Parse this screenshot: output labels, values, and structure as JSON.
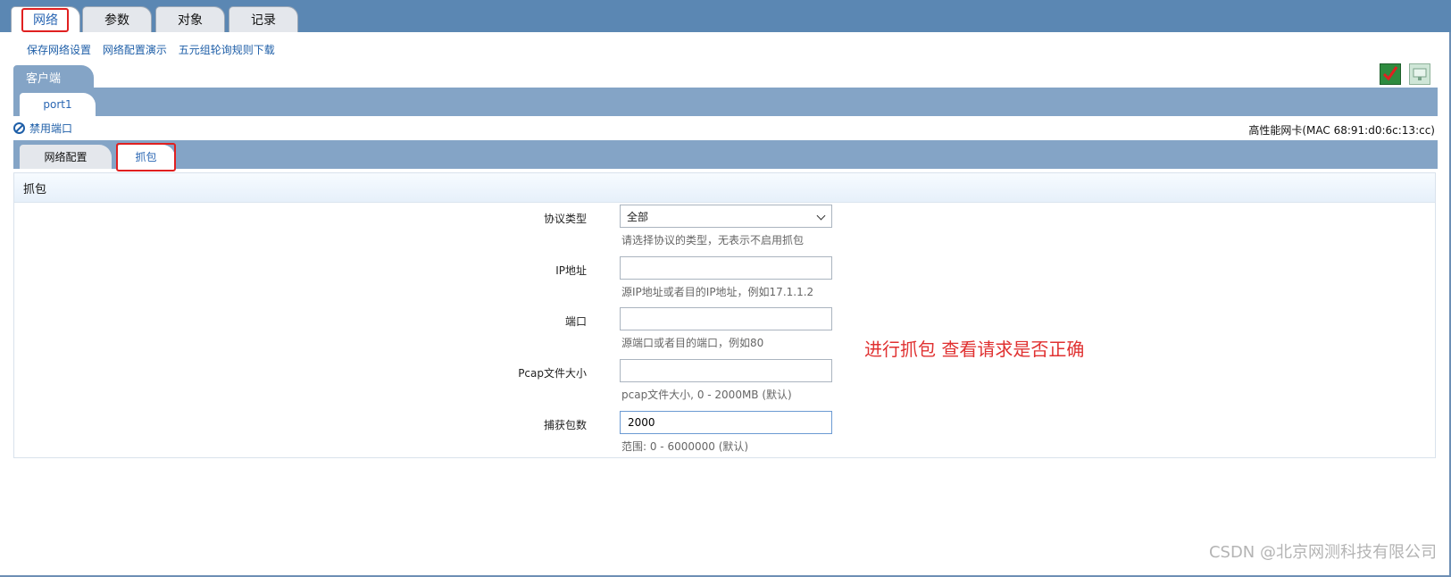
{
  "top_tabs": [
    "网络",
    "参数",
    "对象",
    "记录"
  ],
  "action_links": [
    "保存网络设置",
    "网络配置演示",
    "五元组轮询规则下载"
  ],
  "client_tab": "客户端",
  "port_tab": "port1",
  "icons": {
    "apply": "check-icon",
    "network": "network-card-icon",
    "disable": "ban-icon"
  },
  "disable_port": "禁用端口",
  "nic_info": "高性能网卡(MAC 68:91:d0:6c:13:cc)",
  "sub_tabs": [
    "网络配置",
    "抓包"
  ],
  "panel_title": "抓包",
  "form": {
    "protocol": {
      "label": "协议类型",
      "value": "全部",
      "hint": "请选择协议的类型，无表示不启用抓包"
    },
    "ip": {
      "label": "IP地址",
      "value": "",
      "hint": "源IP地址或者目的IP地址，例如17.1.1.2"
    },
    "port": {
      "label": "端口",
      "value": "",
      "hint": "源端口或者目的端口，例如80"
    },
    "pcap_size": {
      "label": "Pcap文件大小",
      "value": "",
      "hint": "pcap文件大小, 0 - 2000MB (默认)"
    },
    "packet_count": {
      "label": "捕获包数",
      "value": "2000",
      "hint": "范围: 0 - 6000000 (默认)"
    }
  },
  "annotation": "进行抓包 查看请求是否正确",
  "watermark": "CSDN @北京网测科技有限公司",
  "colors": {
    "highlight": "#e02020",
    "bar": "#5b87b3",
    "band": "#84a4c6",
    "link": "#1f5fa8"
  }
}
